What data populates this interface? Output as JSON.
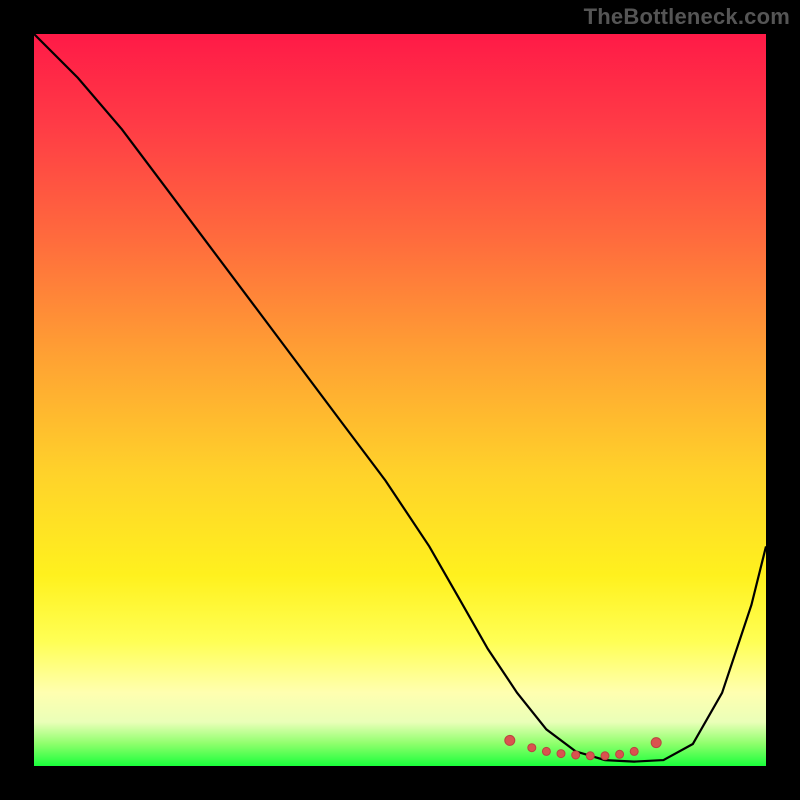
{
  "watermark": "TheBottleneck.com",
  "colors": {
    "curve": "#000000",
    "marker_fill": "#d9534f",
    "marker_stroke": "#b94440"
  },
  "chart_data": {
    "type": "line",
    "title": "",
    "xlabel": "",
    "ylabel": "",
    "xlim": [
      0,
      100
    ],
    "ylim": [
      0,
      100
    ],
    "series": [
      {
        "name": "bottleneck-curve",
        "x": [
          0,
          6,
          12,
          18,
          24,
          30,
          36,
          42,
          48,
          54,
          58,
          62,
          66,
          70,
          74,
          78,
          82,
          86,
          90,
          94,
          98,
          100
        ],
        "y": [
          100,
          94,
          87,
          79,
          71,
          63,
          55,
          47,
          39,
          30,
          23,
          16,
          10,
          5,
          2,
          0.8,
          0.6,
          0.8,
          3,
          10,
          22,
          30
        ]
      }
    ],
    "markers": {
      "name": "optimal-band",
      "x": [
        65,
        68,
        70,
        72,
        74,
        76,
        78,
        80,
        82,
        85
      ],
      "y": [
        3.5,
        2.5,
        2.0,
        1.7,
        1.5,
        1.4,
        1.4,
        1.6,
        2.0,
        3.2
      ]
    }
  }
}
